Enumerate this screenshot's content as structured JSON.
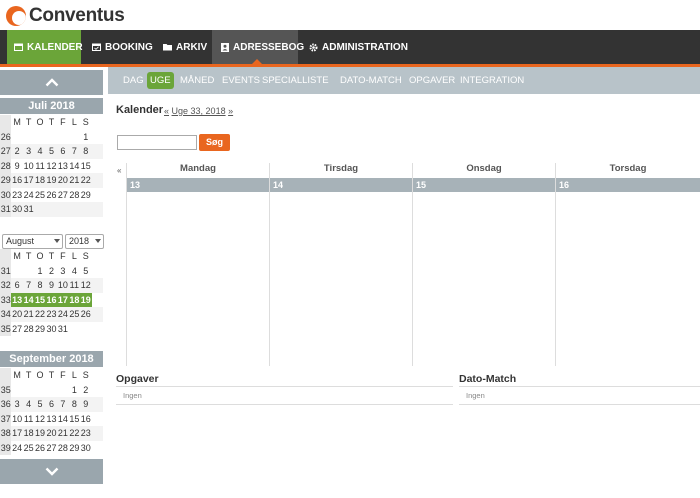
{
  "app": {
    "logo_text": "Conventus",
    "brand_color": "#e9661f",
    "accent_color": "#6ba539"
  },
  "nav": {
    "items": [
      {
        "label": "KALENDER",
        "icon": "calendar-icon",
        "active": true
      },
      {
        "label": "BOOKING",
        "icon": "calendar-check-icon"
      },
      {
        "label": "ARKIV",
        "icon": "folder-icon"
      },
      {
        "label": "ADRESSEBOG",
        "icon": "address-card-icon"
      },
      {
        "label": "ADMINISTRATION",
        "icon": "gear-icon"
      }
    ]
  },
  "subnav": {
    "items": [
      "DAG",
      "UGE",
      "MÅNED",
      "EVENTS",
      "SPECIALLISTE",
      "DATO-MATCH",
      "OPGAVER",
      "INTEGRATION"
    ],
    "active": "UGE"
  },
  "sidebar": {
    "july": {
      "title": "Juli 2018",
      "headers": [
        "",
        "M",
        "T",
        "O",
        "T",
        "F",
        "L",
        "S"
      ],
      "rows": [
        [
          "26",
          "",
          "",
          "",
          "",
          "",
          "",
          "1"
        ],
        [
          "27",
          "2",
          "3",
          "4",
          "5",
          "6",
          "7",
          "8"
        ],
        [
          "28",
          "9",
          "10",
          "11",
          "12",
          "13",
          "14",
          "15"
        ],
        [
          "29",
          "16",
          "17",
          "18",
          "19",
          "20",
          "21",
          "22"
        ],
        [
          "30",
          "23",
          "24",
          "25",
          "26",
          "27",
          "28",
          "29"
        ],
        [
          "31",
          "30",
          "31",
          "",
          "",
          "",
          "",
          ""
        ]
      ]
    },
    "month_select": "August",
    "year_select": "2018",
    "august": {
      "headers": [
        "",
        "M",
        "T",
        "O",
        "T",
        "F",
        "L",
        "S"
      ],
      "rows": [
        [
          "31",
          "",
          "",
          "1",
          "2",
          "3",
          "4",
          "5"
        ],
        [
          "32",
          "6",
          "7",
          "8",
          "9",
          "10",
          "11",
          "12"
        ],
        [
          "33",
          "13",
          "14",
          "15",
          "16",
          "17",
          "18",
          "19"
        ],
        [
          "34",
          "20",
          "21",
          "22",
          "23",
          "24",
          "25",
          "26"
        ],
        [
          "35",
          "27",
          "28",
          "29",
          "30",
          "31",
          "",
          ""
        ]
      ],
      "current_week": "33"
    },
    "september": {
      "title": "September 2018",
      "headers": [
        "",
        "M",
        "T",
        "O",
        "T",
        "F",
        "L",
        "S"
      ],
      "rows": [
        [
          "35",
          "",
          "",
          "",
          "",
          "",
          "1",
          "2"
        ],
        [
          "36",
          "3",
          "4",
          "5",
          "6",
          "7",
          "8",
          "9"
        ],
        [
          "37",
          "10",
          "11",
          "12",
          "13",
          "14",
          "15",
          "16"
        ],
        [
          "38",
          "17",
          "18",
          "19",
          "20",
          "21",
          "22",
          "23"
        ],
        [
          "39",
          "24",
          "25",
          "26",
          "27",
          "28",
          "29",
          "30"
        ]
      ]
    }
  },
  "main": {
    "title": "Kalender",
    "week_nav_prev": "«",
    "week_label": "Uge 33, 2018",
    "week_nav_next": "»",
    "search_button": "Søg",
    "prev_link": "«",
    "days": [
      {
        "name": "Mandag",
        "num": "13"
      },
      {
        "name": "Tirsdag",
        "num": "14"
      },
      {
        "name": "Onsdag",
        "num": "15"
      },
      {
        "name": "Torsdag",
        "num": "16"
      }
    ],
    "tasks_title": "Opgaver",
    "tasks_empty": "Ingen",
    "datematch_title": "Dato-Match",
    "datematch_empty": "Ingen"
  }
}
